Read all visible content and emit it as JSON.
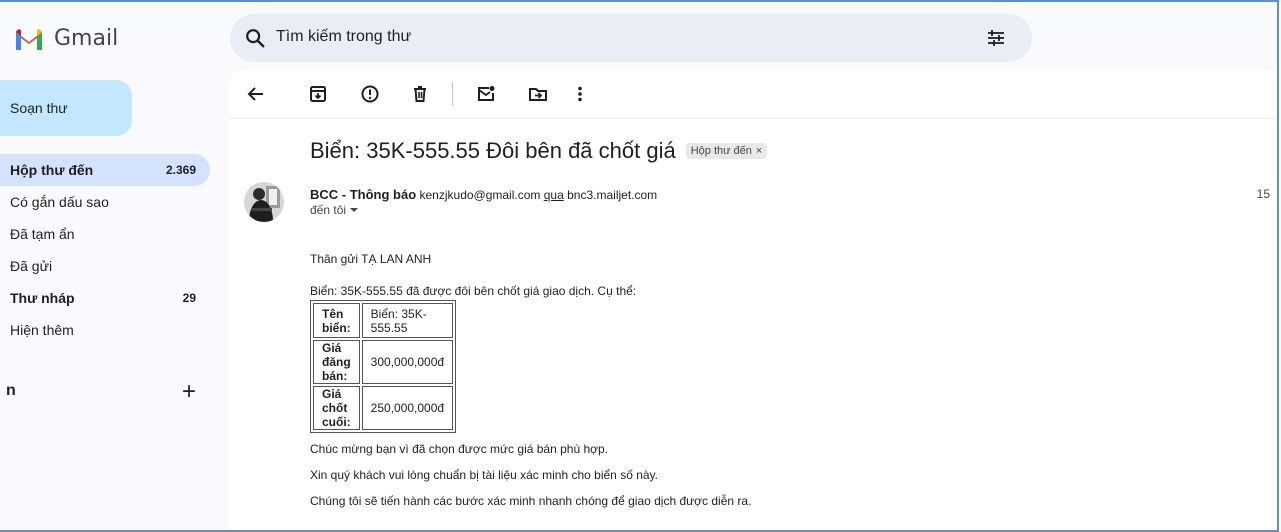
{
  "app": {
    "name": "Gmail"
  },
  "search": {
    "placeholder": "Tìm kiếm trong thư"
  },
  "sidebar": {
    "compose_label": "Soạn thư",
    "items": [
      {
        "label": "Hộp thư đến",
        "count": "2.369"
      },
      {
        "label": "Có gắn dấu sao",
        "count": ""
      },
      {
        "label": "Đã tạm ẩn",
        "count": ""
      },
      {
        "label": "Đã gửi",
        "count": ""
      },
      {
        "label": "Thư nháp",
        "count": "29"
      },
      {
        "label": "Hiện thêm",
        "count": ""
      }
    ],
    "labels_heading": "n",
    "labels_add": "+"
  },
  "toolbar": {
    "icons": [
      "back-arrow-icon",
      "archive-icon",
      "report-spam-icon",
      "delete-icon",
      "mark-unread-icon",
      "move-to-icon",
      "more-vert-icon"
    ]
  },
  "email": {
    "subject": "Biển: 35K-555.55 Đôi bên đã chốt giá",
    "chip_label": "Hộp thư đến",
    "chip_close": "×",
    "sender_name": "BCC - Thông báo",
    "sender_email": "kenzjkudo@gmail.com",
    "via_word": "qua",
    "via_domain": "bnc3.mailjet.com",
    "to_me": "đến tôi",
    "time": "15",
    "greeting": "Thân gửi TẠ LAN ANH",
    "intro": "Biển: 35K-555.55 đã được đôi bên chốt giá giao dịch. Cụ thể:",
    "table": [
      {
        "key": "Tên biển:",
        "value": "Biển: 35K-555.55"
      },
      {
        "key": "Giá đăng bán:",
        "value": "300,000,000đ"
      },
      {
        "key": "Giá chốt cuối:",
        "value": "250,000,000đ"
      }
    ],
    "line1": "Chúc mừng bạn vì đã chọn được mức giá bán phù hợp.",
    "line2": "Xin quý khách vui lòng chuẩn bị tài liệu xác minh cho biển số này.",
    "line3": "Chúng tôi sẽ tiến hành các bước xác minh nhanh chóng để giao dịch được diễn ra."
  },
  "colors": {
    "compose_bg": "#c2e7ff",
    "active_bg": "#d3e3fd",
    "search_bg": "#e9eef6",
    "frame_border": "#5b8fd6"
  }
}
